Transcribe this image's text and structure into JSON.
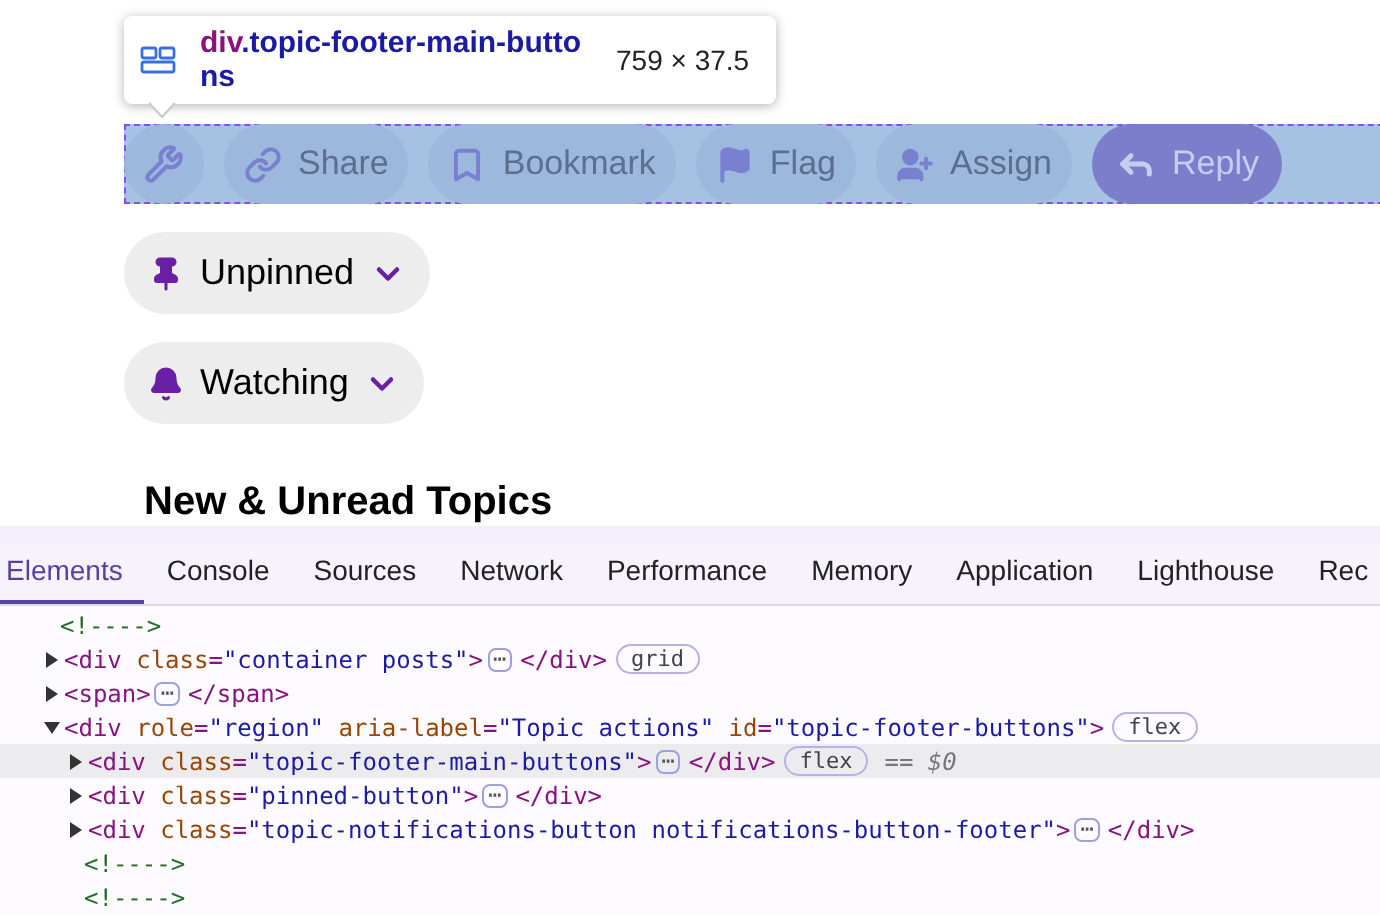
{
  "inspector_tooltip": {
    "tag": "div",
    "class_name": ".topic-footer-main-buttons",
    "size": "759 × 37.5"
  },
  "topic_actions": [
    {
      "kind": "tool"
    },
    {
      "kind": "action",
      "label": "Share"
    },
    {
      "kind": "action",
      "label": "Bookmark"
    },
    {
      "kind": "action",
      "label": "Flag"
    },
    {
      "kind": "action",
      "label": "Assign"
    },
    {
      "kind": "primary",
      "label": "Reply"
    }
  ],
  "dropdowns": [
    {
      "label": "Unpinned"
    },
    {
      "label": "Watching"
    }
  ],
  "heading": "New & Unread Topics",
  "devtools": {
    "tabs": [
      {
        "label": "Elements",
        "selected": true
      },
      {
        "label": "Console",
        "selected": false
      },
      {
        "label": "Sources",
        "selected": false
      },
      {
        "label": "Network",
        "selected": false
      },
      {
        "label": "Performance",
        "selected": false
      },
      {
        "label": "Memory",
        "selected": false
      },
      {
        "label": "Application",
        "selected": false
      },
      {
        "label": "Lighthouse",
        "selected": false
      },
      {
        "label": "Rec",
        "selected": false
      }
    ],
    "tree": [
      {
        "kind": "comment",
        "text": "<!---->"
      },
      {
        "kind": "element",
        "expanded": false,
        "selected": false,
        "tokens": [
          {
            "kind": "tag",
            "text": "<div"
          },
          {
            "kind": "attr_name",
            "text": "class"
          },
          {
            "kind": "punct",
            "text": "="
          },
          {
            "kind": "attr_value",
            "text": "\"container posts\""
          },
          {
            "kind": "tag",
            "text": ">"
          }
        ],
        "ellipsis": "⋯",
        "close": "</div>",
        "badge": "grid"
      },
      {
        "kind": "element",
        "expanded": false,
        "selected": false,
        "tokens": [
          {
            "kind": "tag",
            "text": "<span>"
          }
        ],
        "ellipsis": "⋯",
        "close": "</span>"
      },
      {
        "kind": "element",
        "expanded": true,
        "selected": false,
        "tokens": [
          {
            "kind": "tag",
            "text": "<div"
          },
          {
            "kind": "attr_name",
            "text": "role"
          },
          {
            "kind": "punct",
            "text": "="
          },
          {
            "kind": "attr_value",
            "text": "\"region\""
          },
          {
            "kind": "attr_name",
            "text": "aria-label"
          },
          {
            "kind": "punct",
            "text": "="
          },
          {
            "kind": "attr_value",
            "text": "\"Topic actions\""
          },
          {
            "kind": "attr_name",
            "text": "id"
          },
          {
            "kind": "punct",
            "text": "="
          },
          {
            "kind": "attr_value",
            "text": "\"topic-footer-buttons\""
          },
          {
            "kind": "tag",
            "text": ">"
          }
        ],
        "badge": "flex",
        "children": [
          {
            "kind": "element",
            "expanded": false,
            "selected": true,
            "tokens": [
              {
                "kind": "tag",
                "text": "<div"
              },
              {
                "kind": "attr_name",
                "text": "class"
              },
              {
                "kind": "punct",
                "text": "="
              },
              {
                "kind": "attr_value",
                "text": "\"topic-footer-main-buttons\""
              },
              {
                "kind": "tag",
                "text": ">"
              }
            ],
            "ellipsis": "⋯",
            "close": "</div>",
            "badge": "flex",
            "note": "== $0"
          },
          {
            "kind": "element",
            "expanded": false,
            "selected": false,
            "tokens": [
              {
                "kind": "tag",
                "text": "<div"
              },
              {
                "kind": "attr_name",
                "text": "class"
              },
              {
                "kind": "punct",
                "text": "="
              },
              {
                "kind": "attr_value",
                "text": "\"pinned-button\""
              },
              {
                "kind": "tag",
                "text": ">"
              }
            ],
            "ellipsis": "⋯",
            "close": "</div>"
          },
          {
            "kind": "element",
            "expanded": false,
            "selected": false,
            "tokens": [
              {
                "kind": "tag",
                "text": "<div"
              },
              {
                "kind": "attr_name",
                "text": "class"
              },
              {
                "kind": "punct",
                "text": "="
              },
              {
                "kind": "attr_value",
                "text": "\"topic-notifications-button notifications-button-footer\""
              },
              {
                "kind": "tag",
                "text": ">"
              }
            ],
            "ellipsis": "⋯",
            "close": "</div>"
          },
          {
            "kind": "comment",
            "text": "<!---->"
          },
          {
            "kind": "comment",
            "text": "<!---->"
          }
        ]
      }
    ]
  }
}
